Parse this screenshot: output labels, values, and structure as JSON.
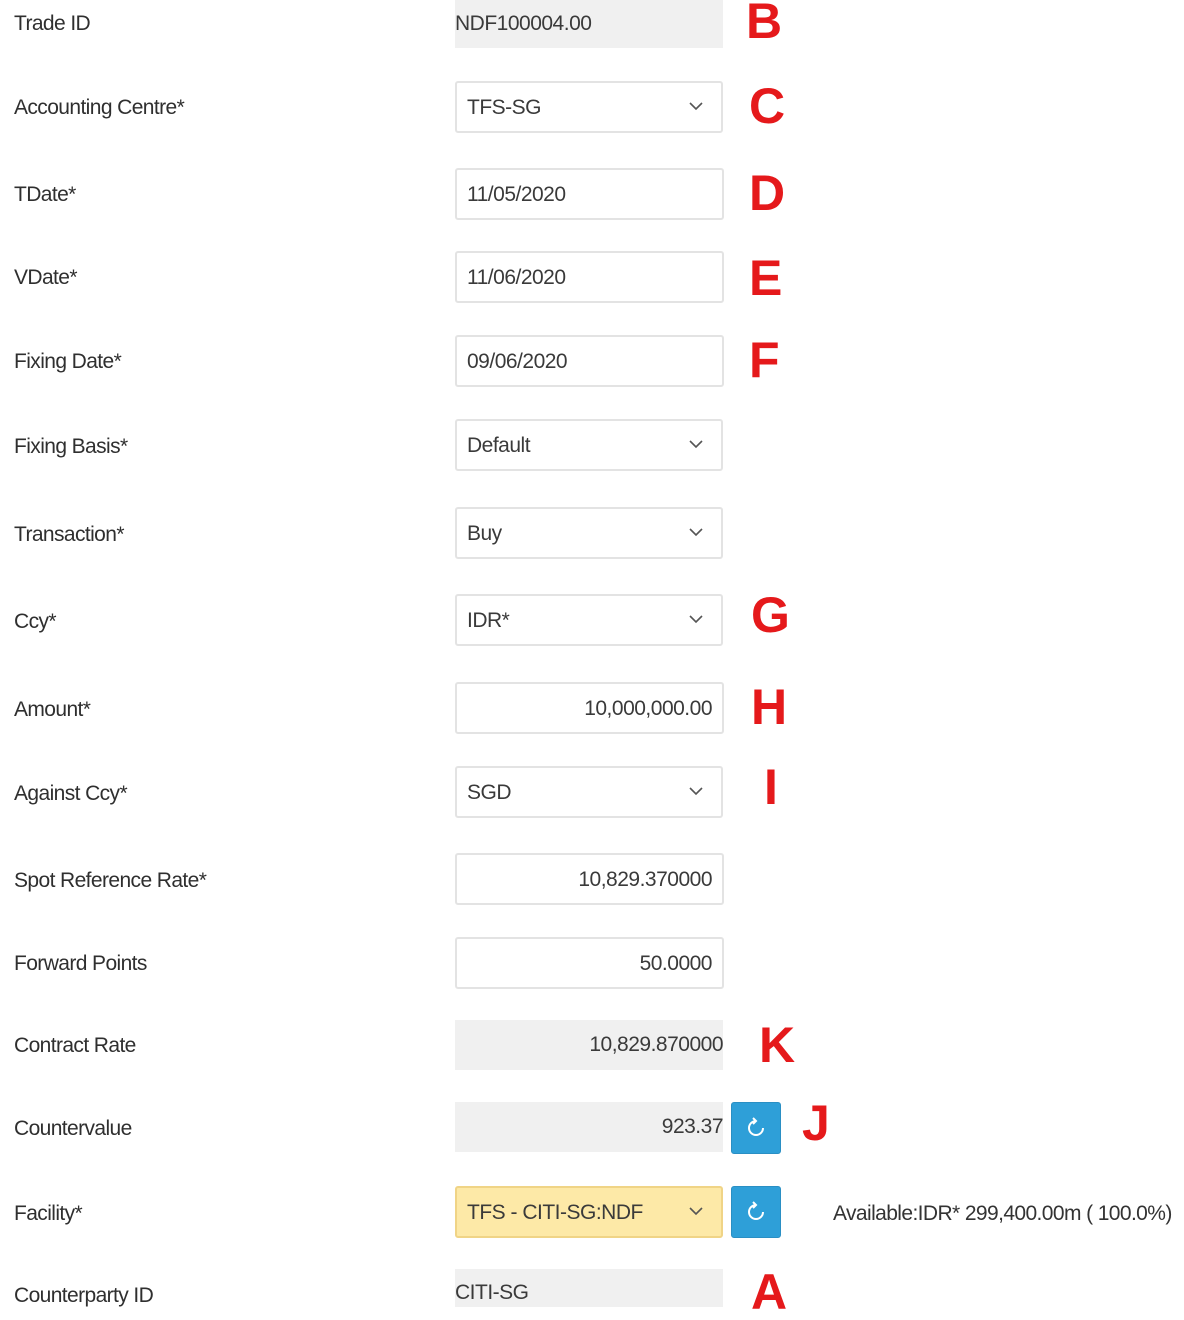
{
  "rows": [
    {
      "label": "Trade ID",
      "value": "NDF100004.00",
      "marker": "B"
    },
    {
      "label": "Accounting Centre*",
      "value": "TFS-SG",
      "marker": "C"
    },
    {
      "label": "TDate*",
      "value": "11/05/2020",
      "marker": "D"
    },
    {
      "label": "VDate*",
      "value": "11/06/2020",
      "marker": "E"
    },
    {
      "label": "Fixing Date*",
      "value": "09/06/2020",
      "marker": "F"
    },
    {
      "label": "Fixing Basis*",
      "value": "Default"
    },
    {
      "label": "Transaction*",
      "value": "Buy"
    },
    {
      "label": "Ccy*",
      "value": "IDR*",
      "marker": "G"
    },
    {
      "label": "Amount*",
      "value": "10,000,000.00",
      "marker": "H"
    },
    {
      "label": "Against Ccy*",
      "value": "SGD",
      "marker": "I"
    },
    {
      "label": "Spot Reference Rate*",
      "value": "10,829.370000"
    },
    {
      "label": "Forward Points",
      "value": "50.0000"
    },
    {
      "label": "Contract Rate",
      "value": "10,829.870000",
      "marker": "K"
    },
    {
      "label": "Countervalue",
      "value": "923.37",
      "marker": "J"
    },
    {
      "label": "Facility*",
      "value": "TFS - CITI-SG:NDF",
      "available": "Available:IDR* 299,400.00m ( 100.0%)"
    },
    {
      "label": "Counterparty ID",
      "value": "CITI-SG",
      "marker": "A"
    }
  ],
  "colors": {
    "marker": "#e5191b",
    "refresh_button": "#2e9fd8",
    "facility_highlight": "#fde9a7",
    "readonly_bg": "#f0f0f0"
  },
  "icons": {
    "dropdown": "chevron-down-icon",
    "refresh": "refresh-icon"
  }
}
